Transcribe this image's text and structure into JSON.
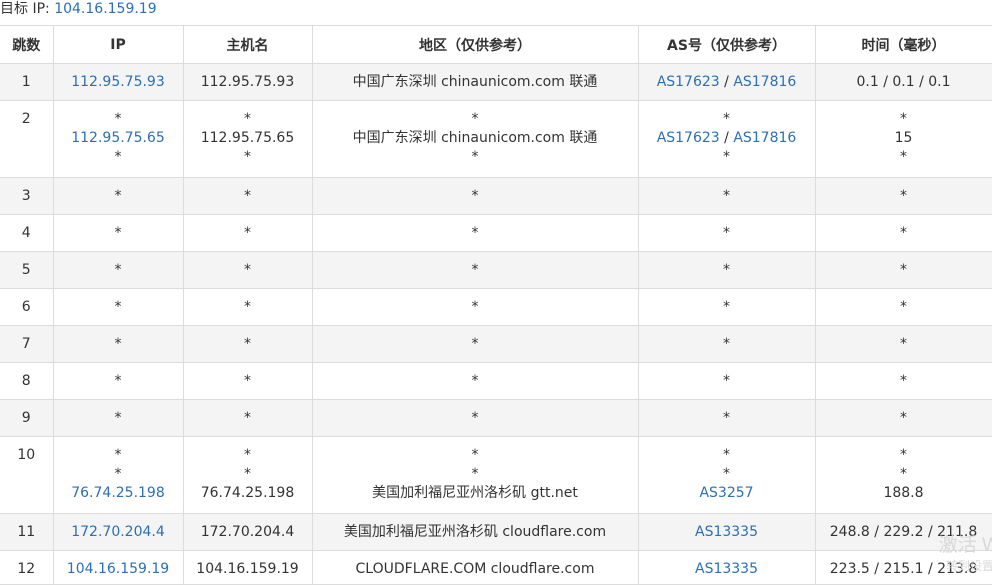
{
  "target": {
    "label": "目标 IP:",
    "ip": "104.16.159.19"
  },
  "columns": [
    "跳数",
    "IP",
    "主机名",
    "地区（仅供参考）",
    "AS号（仅供参考）",
    "时间（毫秒）"
  ],
  "rows": [
    {
      "hop": "1",
      "ip": [
        "112.95.75.93"
      ],
      "host": [
        "112.95.75.93"
      ],
      "region": [
        "中国广东深圳 chinaunicom.com 联通"
      ],
      "as": [
        [
          "AS17623",
          "AS17816"
        ]
      ],
      "time": [
        "0.1 / 0.1 / 0.1"
      ]
    },
    {
      "hop": "2",
      "ip": [
        "*",
        "112.95.75.65",
        "*"
      ],
      "host": [
        "*",
        "112.95.75.65",
        "*"
      ],
      "region": [
        "*",
        "中国广东深圳 chinaunicom.com 联通",
        "*"
      ],
      "as": [
        [
          "*"
        ],
        [
          "AS17623",
          "AS17816"
        ],
        [
          "*"
        ]
      ],
      "time": [
        "*",
        "15",
        "*"
      ]
    },
    {
      "hop": "3",
      "ip": [
        "*"
      ],
      "host": [
        "*"
      ],
      "region": [
        "*"
      ],
      "as": [
        [
          "*"
        ]
      ],
      "time": [
        "*"
      ]
    },
    {
      "hop": "4",
      "ip": [
        "*"
      ],
      "host": [
        "*"
      ],
      "region": [
        "*"
      ],
      "as": [
        [
          "*"
        ]
      ],
      "time": [
        "*"
      ]
    },
    {
      "hop": "5",
      "ip": [
        "*"
      ],
      "host": [
        "*"
      ],
      "region": [
        "*"
      ],
      "as": [
        [
          "*"
        ]
      ],
      "time": [
        "*"
      ]
    },
    {
      "hop": "6",
      "ip": [
        "*"
      ],
      "host": [
        "*"
      ],
      "region": [
        "*"
      ],
      "as": [
        [
          "*"
        ]
      ],
      "time": [
        "*"
      ]
    },
    {
      "hop": "7",
      "ip": [
        "*"
      ],
      "host": [
        "*"
      ],
      "region": [
        "*"
      ],
      "as": [
        [
          "*"
        ]
      ],
      "time": [
        "*"
      ]
    },
    {
      "hop": "8",
      "ip": [
        "*"
      ],
      "host": [
        "*"
      ],
      "region": [
        "*"
      ],
      "as": [
        [
          "*"
        ]
      ],
      "time": [
        "*"
      ]
    },
    {
      "hop": "9",
      "ip": [
        "*"
      ],
      "host": [
        "*"
      ],
      "region": [
        "*"
      ],
      "as": [
        [
          "*"
        ]
      ],
      "time": [
        "*"
      ]
    },
    {
      "hop": "10",
      "ip": [
        "*",
        "*",
        "76.74.25.198"
      ],
      "host": [
        "*",
        "*",
        "76.74.25.198"
      ],
      "region": [
        "*",
        "*",
        "美国加利福尼亚州洛杉矶 gtt.net"
      ],
      "as": [
        [
          "*"
        ],
        [
          "*"
        ],
        [
          "AS3257"
        ]
      ],
      "time": [
        "*",
        "*",
        "188.8"
      ]
    },
    {
      "hop": "11",
      "ip": [
        "172.70.204.4"
      ],
      "host": [
        "172.70.204.4"
      ],
      "region": [
        "美国加利福尼亚州洛杉矶 cloudflare.com"
      ],
      "as": [
        [
          "AS13335"
        ]
      ],
      "time": [
        "248.8 / 229.2 / 211.8"
      ]
    },
    {
      "hop": "12",
      "ip": [
        "104.16.159.19"
      ],
      "host": [
        "104.16.159.19"
      ],
      "region": [
        "CLOUDFLARE.COM cloudflare.com"
      ],
      "as": [
        [
          "AS13335"
        ]
      ],
      "time": [
        "223.5 / 215.1 / 213.8"
      ]
    }
  ],
  "watermark": {
    "line1": "激活 W",
    "line2": "转到设置"
  },
  "colors": {
    "link": "#2c6fb3",
    "border": "#dcdcdc",
    "alt_row": "#f4f4f4"
  }
}
